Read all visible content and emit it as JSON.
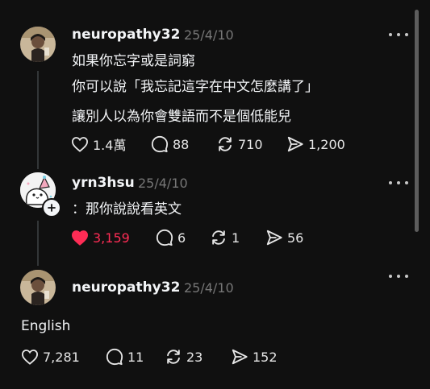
{
  "posts": [
    {
      "username": "neuropathy32",
      "date": "25/4/10",
      "lines": [
        "如果你忘字或是詞窮",
        "你可以說「我忘記這字在中文怎麼講了」",
        "讓別人以為你會雙語而不是個低能兒"
      ],
      "likes": "1.4萬",
      "comments": "88",
      "reposts": "710",
      "shares": "1,200"
    },
    {
      "username": "yrn3hsu",
      "date": "25/4/10",
      "lines": [
        "：那你說說看英文"
      ],
      "likes": "3,159",
      "comments": "6",
      "reposts": "1",
      "shares": "56"
    },
    {
      "username": "neuropathy32",
      "date": "25/4/10",
      "lines": [
        "English"
      ],
      "likes": "7,281",
      "comments": "11",
      "reposts": "23",
      "shares": "152"
    }
  ],
  "colors": {
    "background": "#101010",
    "like_active": "#fe2c55",
    "muted": "#777777"
  },
  "icons": [
    "heart-icon",
    "comment-icon",
    "repost-icon",
    "share-icon",
    "more-icon",
    "plus-icon"
  ]
}
